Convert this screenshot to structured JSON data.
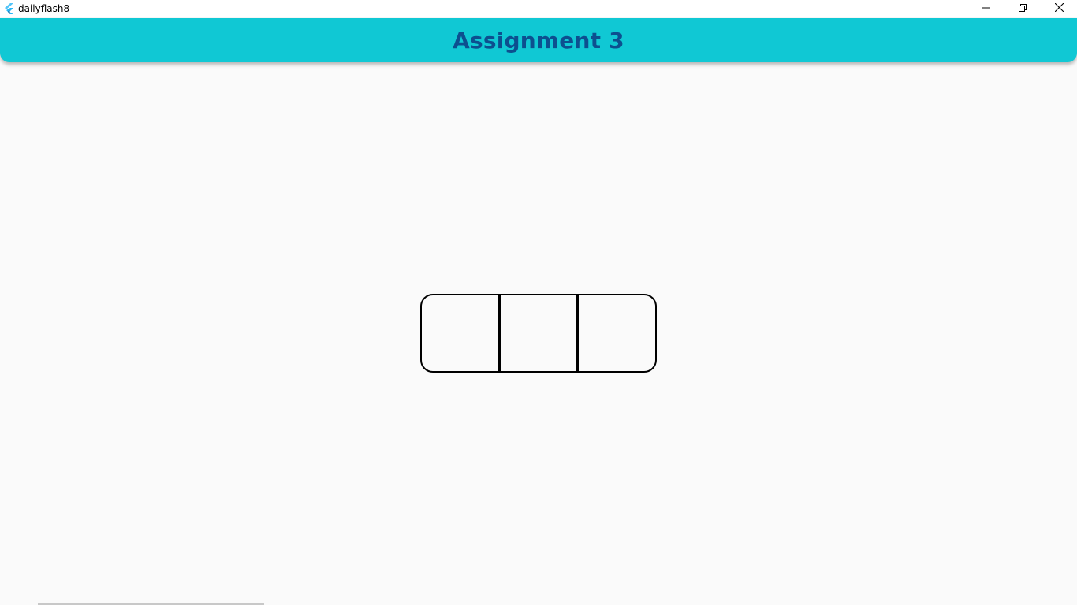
{
  "window": {
    "title": "dailyflash8",
    "icons": {
      "app": "flutter-logo-icon",
      "minimize": "minimize-icon",
      "maximize": "restore-icon",
      "close": "close-icon"
    }
  },
  "appbar": {
    "title": "Assignment 3",
    "background": "#10c8d4",
    "title_color": "#0d4f8f"
  },
  "content": {
    "segments": [
      {
        "label": ""
      },
      {
        "label": ""
      },
      {
        "label": ""
      }
    ]
  }
}
